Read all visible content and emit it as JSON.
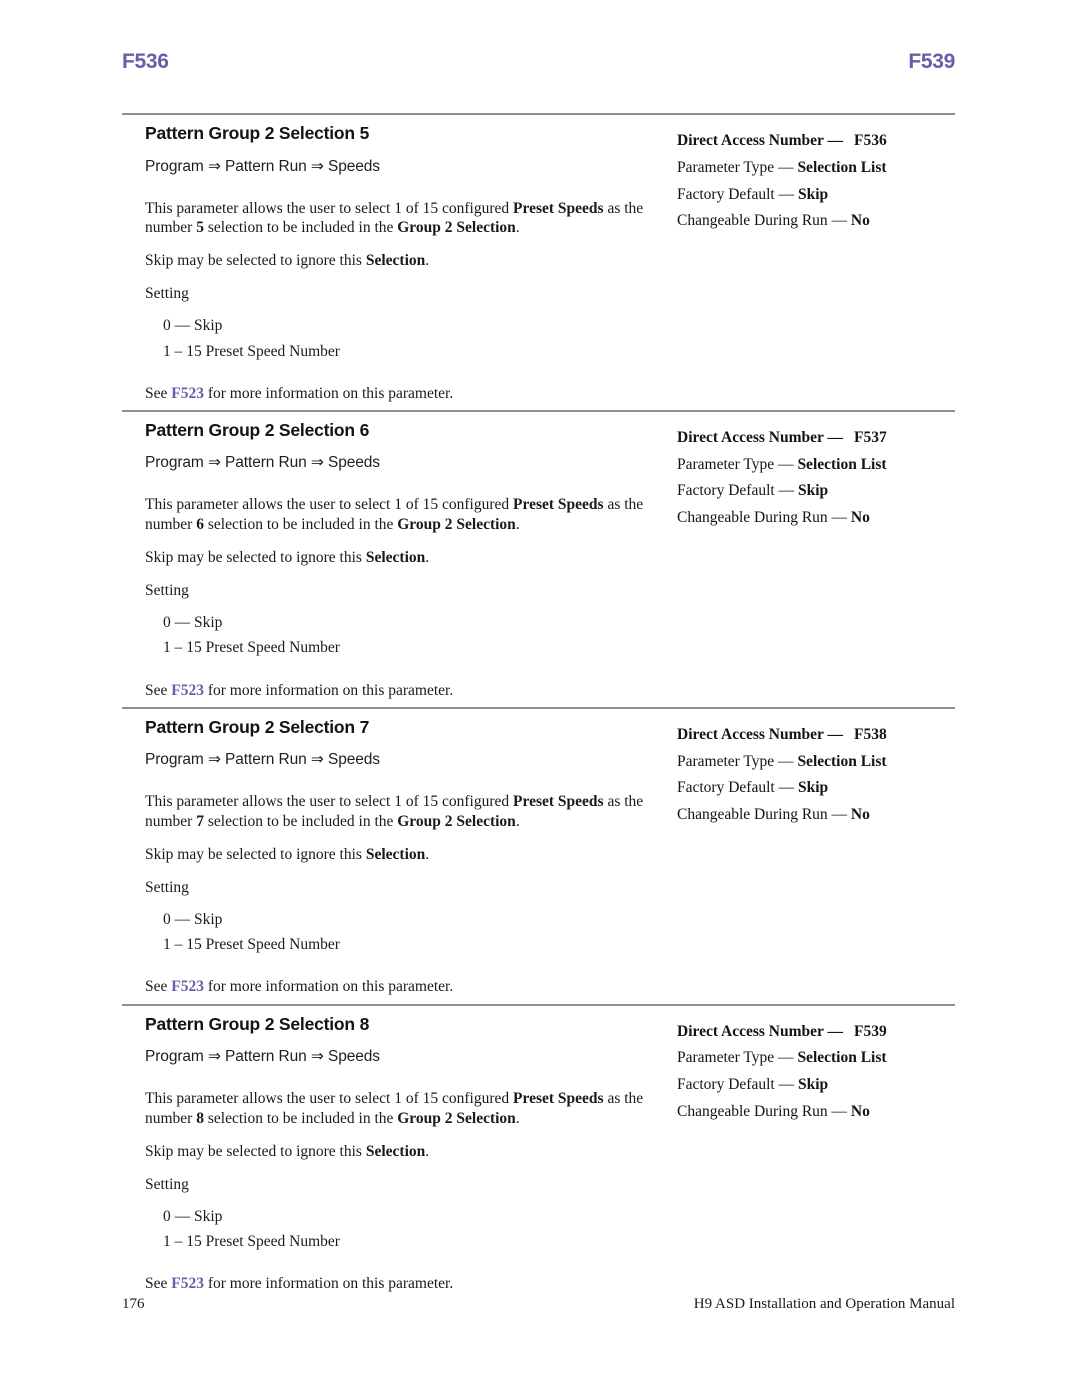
{
  "header": {
    "left": "F536",
    "right": "F539",
    "accent_color": "#6B5BA8"
  },
  "footer": {
    "page_number": "176",
    "manual_title": "H9 ASD Installation and Operation Manual"
  },
  "labels": {
    "setting": "Setting",
    "skip_note_pre": "Skip may be selected to ignore this ",
    "skip_note_bold": "Selection",
    "skip_note_post": ".",
    "see_pre": "See ",
    "see_ref": "F523",
    "see_post": " for more information on this parameter.",
    "desc_part1": "This parameter allows the user to select 1 of 15 configured ",
    "desc_bold1": "Preset Speeds",
    "desc_part2": " as the number ",
    "desc_part3": " selection to be included in the ",
    "desc_bold2": "Group 2 Selection",
    "desc_part4": ".",
    "meta_direct_access": "Direct Access Number —",
    "meta_param_type_label": "Parameter Type — ",
    "meta_factory_default_label": "Factory Default — ",
    "meta_changeable_label": "Changeable During Run — "
  },
  "sections": [
    {
      "title": "Pattern Group 2 Selection 5",
      "path": "Program ⇒ Pattern Run ⇒ Speeds",
      "number": "5",
      "settings": [
        "0 — Skip",
        "1 – 15 Preset Speed Number"
      ],
      "meta": {
        "direct_access_number": "F536",
        "parameter_type": "Selection List",
        "factory_default": "Skip",
        "changeable_during_run": "No"
      }
    },
    {
      "title": "Pattern Group 2 Selection 6",
      "path": "Program ⇒ Pattern Run ⇒ Speeds",
      "number": "6",
      "settings": [
        "0 — Skip",
        "1 – 15 Preset Speed Number"
      ],
      "meta": {
        "direct_access_number": "F537",
        "parameter_type": "Selection List",
        "factory_default": "Skip",
        "changeable_during_run": "No"
      }
    },
    {
      "title": "Pattern Group 2 Selection 7",
      "path": "Program ⇒ Pattern Run ⇒ Speeds",
      "number": "7",
      "settings": [
        "0 — Skip",
        "1 – 15 Preset Speed Number"
      ],
      "meta": {
        "direct_access_number": "F538",
        "parameter_type": "Selection List",
        "factory_default": "Skip",
        "changeable_during_run": "No"
      }
    },
    {
      "title": "Pattern Group 2 Selection 8",
      "path": "Program ⇒ Pattern Run ⇒ Speeds",
      "number": "8",
      "settings": [
        "0 — Skip",
        "1 – 15 Preset Speed Number"
      ],
      "meta": {
        "direct_access_number": "F539",
        "parameter_type": "Selection List",
        "factory_default": "Skip",
        "changeable_during_run": "No"
      }
    }
  ]
}
